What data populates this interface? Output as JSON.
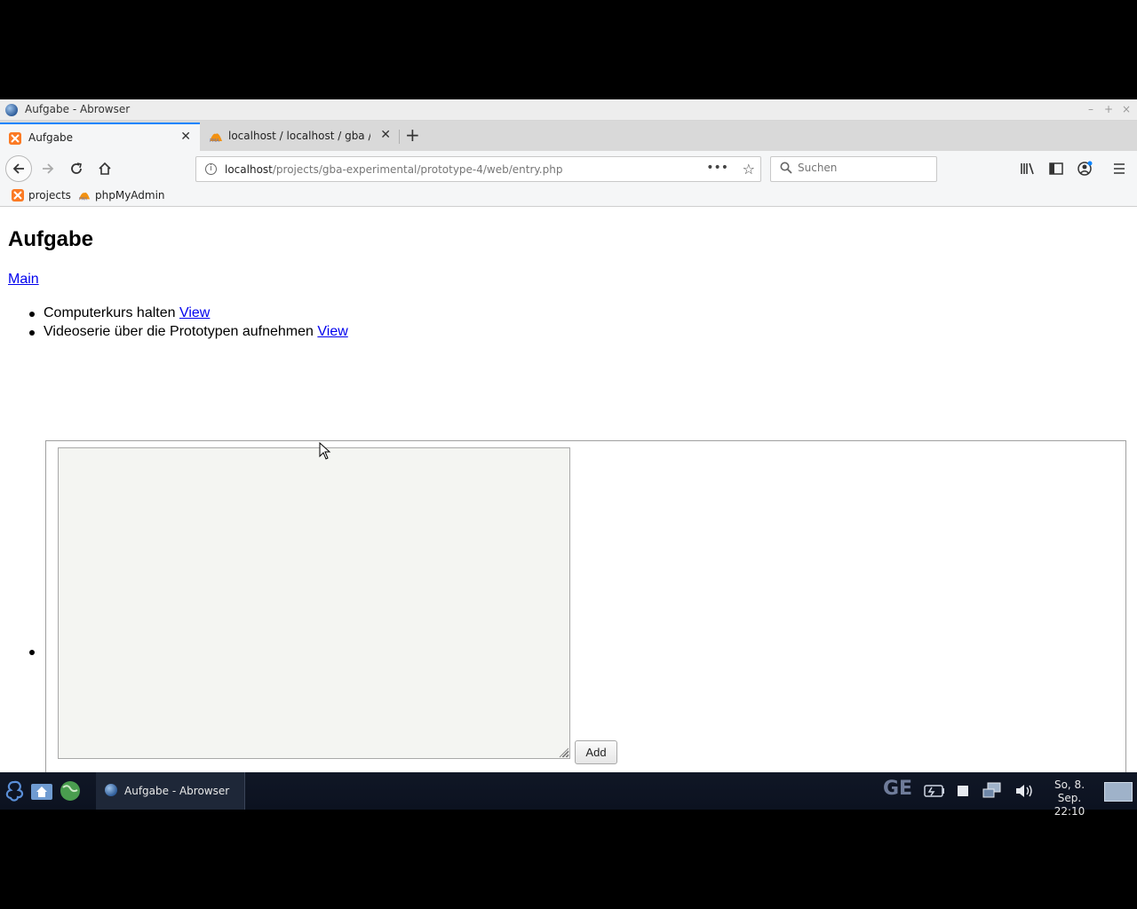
{
  "window": {
    "title": "Aufgabe - Abrowser",
    "controls": {
      "minimize": "–",
      "maximize": "+",
      "close": "×"
    }
  },
  "tabs": [
    {
      "label": "Aufgabe",
      "icon": "xampp-icon",
      "active": true
    },
    {
      "label": "localhost / localhost / gba / le",
      "icon": "phpmyadmin-icon",
      "active": false
    }
  ],
  "toolbar": {
    "url_host": "localhost",
    "url_path": "/projects/gba-experimental/prototype-4/web/entry.php",
    "page_actions": "•••",
    "search_placeholder": "Suchen"
  },
  "bookmarks": [
    {
      "label": "projects",
      "icon": "xampp-icon"
    },
    {
      "label": "phpMyAdmin",
      "icon": "phpmyadmin-icon"
    }
  ],
  "page": {
    "heading": "Aufgabe",
    "main_link": "Main",
    "items": [
      {
        "text": "Computerkurs halten",
        "link": "View"
      },
      {
        "text": "Videoserie über die Prototypen aufnehmen",
        "link": "View"
      }
    ],
    "textarea_value": "",
    "add_button": "Add"
  },
  "taskbar": {
    "task_label": "Aufgabe - Abrowser",
    "keyboard_layout": "GE",
    "clock_date": "So, 8. Sep.",
    "clock_time": "22:10"
  },
  "colors": {
    "accent_tab": "#0a84ff",
    "link": "#0000ee",
    "taskbar_bg": "#101726"
  }
}
